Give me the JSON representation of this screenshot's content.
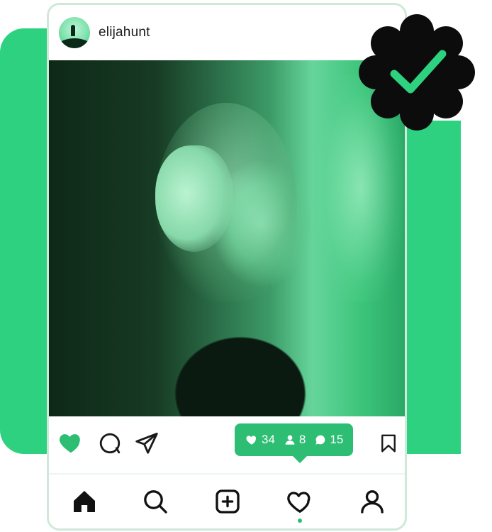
{
  "post": {
    "username": "elijahunt",
    "avatar_icon": "avatar-silhouette-icon"
  },
  "actions": {
    "like_icon": "heart-filled-icon",
    "comment_icon": "comment-icon",
    "share_icon": "send-icon",
    "bookmark_icon": "bookmark-icon",
    "stats": {
      "likes": "34",
      "followers": "8",
      "comments": "15"
    }
  },
  "nav": {
    "items": [
      {
        "name": "home",
        "icon": "home-icon"
      },
      {
        "name": "search",
        "icon": "search-icon"
      },
      {
        "name": "create",
        "icon": "plus-square-icon"
      },
      {
        "name": "activity",
        "icon": "heart-icon"
      },
      {
        "name": "profile",
        "icon": "user-icon"
      }
    ]
  },
  "badge": {
    "icon": "verified-check-icon"
  },
  "colors": {
    "accent": "#2dd17f",
    "accent_dark": "#2dbd73",
    "badge": "#0c0c0c",
    "text": "#1c1c1c"
  }
}
